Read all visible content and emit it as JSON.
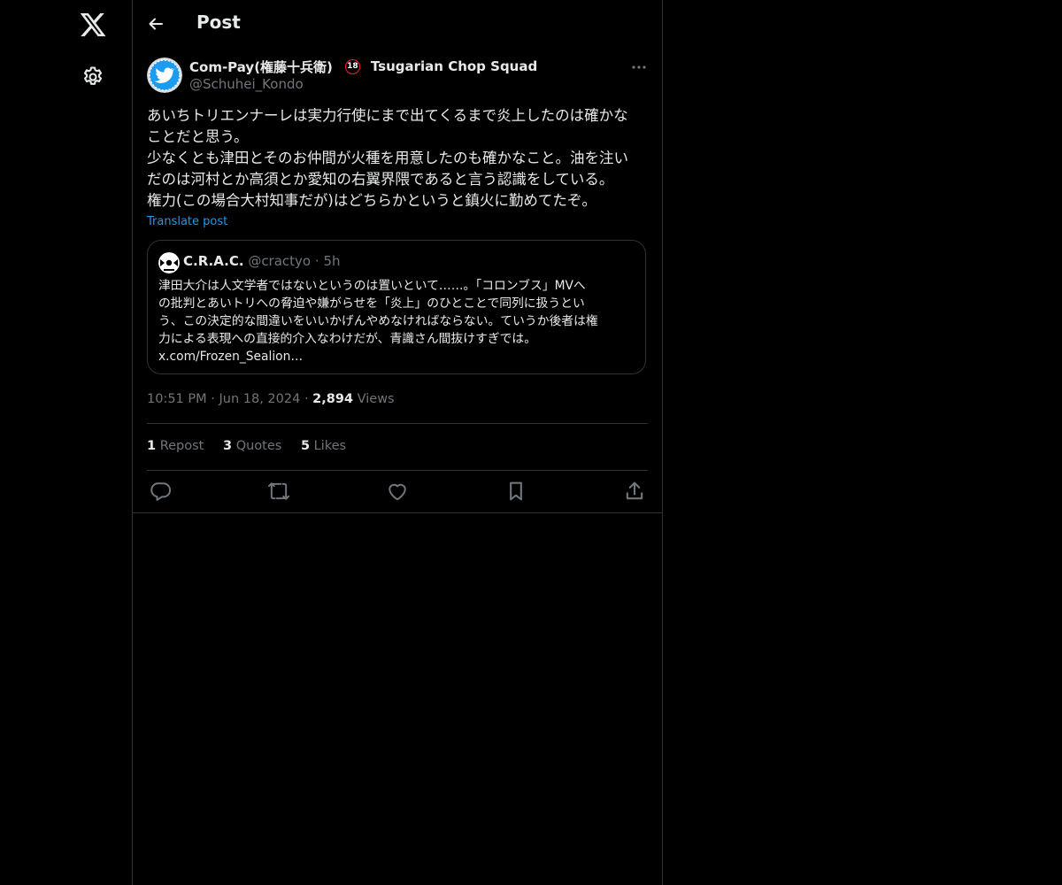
{
  "header": {
    "title": "Post"
  },
  "post": {
    "author_name": "Com-Pay(権藤十兵衛)",
    "badge": "18",
    "affiliation": "Tsugarian Chop Squad",
    "handle": "@Schuhei_Kondo",
    "text_lines": [
      "あいちトリエンナーレは実力行使にまで出てくるまで炎上したのは確かな",
      "ことだと思う。",
      "少なくとも津田とそのお仲間が火種を用意したのも確かなこと。油を注い",
      "だのは河村とか高須とか愛知の右翼界隈であると言う認識をしている。",
      "権力(この場合大村知事だが)はどちらかというと鎮火に勤めてたぞ。"
    ],
    "translate_label": "Translate post",
    "time": "10:51 PM",
    "date": "Jun 18, 2024",
    "views_count": "2,894",
    "views_label": "Views",
    "reposts_count": "1",
    "reposts_label": "Repost",
    "quotes_count": "3",
    "quotes_label": "Quotes",
    "likes_count": "5",
    "likes_label": "Likes"
  },
  "quote": {
    "name": "C.R.A.C.",
    "handle": "@cractyo",
    "separator": "·",
    "age": "5h",
    "text_lines": [
      "津田大介は人文学者ではないというのは置いといて……。「コロンブス」MVへ",
      "の批判とあいトリへの脅迫や嫌がらせを「炎上」のひとことで同列に扱うとい",
      "う、この決定的な間違いをいいかげんやめなければならない。ていうか後者は権",
      "力による表現への直接的介入なわけだが、青識さん間抜けすぎでは。",
      "x.com/Frozen_Sealion…"
    ]
  },
  "meta_separator": "·",
  "colors": {
    "background": "#000000",
    "text": "#e7e9ea",
    "muted": "#71767b",
    "accent": "#1d9bf0",
    "border": "#2f3336",
    "badge_ring": "#f4212e"
  },
  "icons": {
    "logo": "x-logo-icon",
    "settings": "gear-icon",
    "back": "arrow-left-icon",
    "more": "more-horizontal-icon",
    "reply": "reply-icon",
    "repost": "repost-icon",
    "like": "heart-icon",
    "bookmark": "bookmark-icon",
    "share": "share-icon"
  }
}
